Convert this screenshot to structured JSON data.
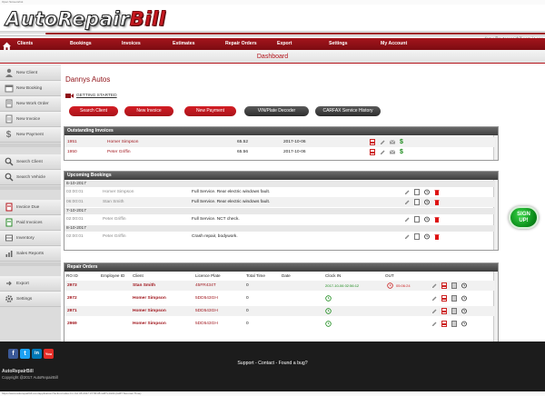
{
  "window_title": "Open Screenshot",
  "logo": {
    "part1": "AutoRepair",
    "part2": "Bill"
  },
  "user_link": "demo@autorepairbill.com | Logo",
  "nav": [
    "Clients",
    "Bookings",
    "Invoices",
    "Estimates",
    "Repair Orders",
    "Export",
    "Settings",
    "My Account"
  ],
  "page_title": "Dashboard",
  "sidebar": [
    {
      "label": "New Client",
      "icon": "person-add-icon"
    },
    {
      "label": "New Booking",
      "icon": "calendar-icon"
    },
    {
      "label": "New Work Order",
      "icon": "wrench-icon"
    },
    {
      "label": "New Invoice",
      "icon": "document-icon"
    },
    {
      "label": "New Payment",
      "icon": "dollar-icon"
    },
    {
      "label": "Search Client",
      "icon": "search-icon"
    },
    {
      "label": "Search Vehicle",
      "icon": "search-icon"
    },
    {
      "label": "Invoice Due",
      "icon": "invoice-due-icon"
    },
    {
      "label": "Paid Invoices",
      "icon": "paid-invoice-icon"
    },
    {
      "label": "Inventory",
      "icon": "inventory-icon"
    },
    {
      "label": "Sales Reports",
      "icon": "chart-icon"
    },
    {
      "label": "Export",
      "icon": "export-icon"
    },
    {
      "label": "Settings",
      "icon": "gear-icon"
    }
  ],
  "company_name": "Dannys Autos",
  "getting_started": "GETTING STARTED",
  "buttons": {
    "search_client": "Search Client",
    "new_invoice": "New Invoice",
    "new_payment": "New Payment",
    "vin_decoder": "VIN/Plate Decoder",
    "carfax": "CARFAX Service History"
  },
  "outstanding": {
    "title": "Outstanding Invoices",
    "rows": [
      {
        "id": "1951",
        "client": "Homer Simpson",
        "amount": "65.52",
        "date": "2017-10-06"
      },
      {
        "id": "1950",
        "client": "Peter Griffin",
        "amount": "65.56",
        "date": "2017-10-06"
      }
    ]
  },
  "upcoming": {
    "title": "Upcoming Bookings",
    "groups": [
      {
        "date": "6-10-2017",
        "rows": [
          {
            "time": "03:00:01",
            "client": "Homer Simpson",
            "desc": "Full Service. Rear electric windows fault."
          },
          {
            "time": "06:00:01",
            "client": "Stan Smith",
            "desc": "Full Service. Rear electric windows fault."
          }
        ]
      },
      {
        "date": "7-10-2017",
        "rows": [
          {
            "time": "02:00:01",
            "client": "Peter Griffin",
            "desc": "Full Service. NCT check."
          }
        ]
      },
      {
        "date": "8-10-2017",
        "rows": [
          {
            "time": "02:00:01",
            "client": "Peter Griffin",
            "desc": "Crash repair, bodywork."
          }
        ]
      }
    ]
  },
  "repair_orders": {
    "title": "Repair Orders",
    "columns": [
      "RO ID",
      "Employee ID",
      "Client",
      "Licence Plate",
      "Total Time",
      "Date",
      "Clock IN",
      "OUT"
    ],
    "rows": [
      {
        "id": "2973",
        "client": "Stan Smith",
        "plate": "45FR434T",
        "total": "0",
        "clock_in": "2017-10-06 02:56:12",
        "out": "05:06:24"
      },
      {
        "id": "2972",
        "client": "Homer Simpson",
        "plate": "5DD543GH",
        "total": "0",
        "clock_in": "",
        "out": ""
      },
      {
        "id": "2971",
        "client": "Homer Simpson",
        "plate": "5DD543GH",
        "total": "0",
        "clock_in": "",
        "out": ""
      },
      {
        "id": "2969",
        "client": "Homer Simpson",
        "plate": "5DD543GH",
        "total": "0",
        "clock_in": "",
        "out": ""
      }
    ]
  },
  "signup": {
    "line1": "SIGN",
    "line2": "UP!"
  },
  "social": [
    "f",
    "t",
    "in",
    "You"
  ],
  "footer": {
    "links": "Support - Contact - Found a bug?",
    "brand": "AutoRepairBill",
    "copyright": "Copyright @2017 AutoRepairBill"
  },
  "statusbar": "https://www.autorepairbill.com/application/?action=index Fri Oct 06 2017 07:56:08 GMT+0100 (GMT Summer Time)",
  "colors": {
    "brand_red": "#9e1a22",
    "dark_bar": "#3e3e3e",
    "green": "#0b8c1a"
  }
}
